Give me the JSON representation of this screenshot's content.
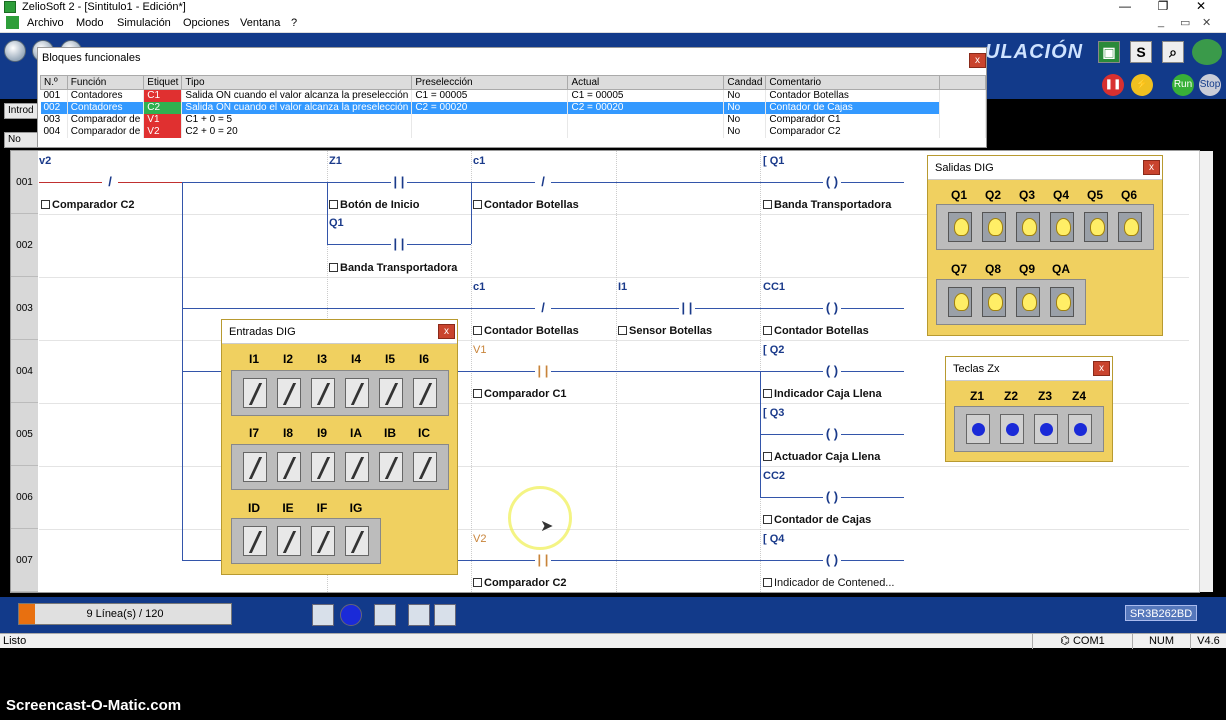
{
  "window": {
    "title": "ZelioSoft 2 - [Sintitulo1 - Edición*]",
    "min": "—",
    "max": "❐",
    "close": "✕",
    "mdi_min": "_",
    "mdi_restore": "▭",
    "mdi_close": "✕"
  },
  "menu": [
    "Archivo",
    "Modo",
    "Simulación",
    "Opciones",
    "Ventana",
    "?"
  ],
  "toolbar": {
    "mode_label": "ULACIÓN",
    "s_label": "S",
    "run_label": "Run",
    "stop_label": "Stop"
  },
  "left_tabs": [
    "Introd",
    "No"
  ],
  "function_blocks": {
    "title": "Bloques funcionales",
    "close": "x",
    "headers": [
      "N.º",
      "Función",
      "Etiquet",
      "Tipo",
      "Preselección",
      "Actual",
      "Candad",
      "Comentario"
    ],
    "rows": [
      [
        "001",
        "Contadores",
        "C1",
        "Salida ON cuando el valor alcanza la preselección",
        "C1 = 00005",
        "C1 = 00005",
        "No",
        "Contador Botellas"
      ],
      [
        "002",
        "Contadores",
        "C2",
        "Salida ON cuando el valor alcanza la preselección",
        "C2 = 00020",
        "C2 = 00020",
        "No",
        "Contador de Cajas"
      ],
      [
        "003",
        "Comparador de",
        "V1",
        "C1 + 0 = 5",
        "",
        "",
        "No",
        "Comparador C1"
      ],
      [
        "004",
        "Comparador de",
        "V2",
        "C2 + 0 = 20",
        "",
        "",
        "No",
        "Comparador C2"
      ]
    ]
  },
  "ladder": {
    "rows": [
      "001",
      "002",
      "003",
      "004",
      "005",
      "006",
      "007"
    ],
    "labels": {
      "r1_v2": "v2",
      "r1_z1": "Z1",
      "r1_c1": "c1",
      "r1_q1": "[ Q1",
      "r1_cm_v2": "Comparador C2",
      "r1_cm_z1": "Botón de Inicio",
      "r1_cm_c1": "Contador Botellas",
      "r1_cm_q1": "Banda Transportadora",
      "r2_q1": "Q1",
      "r2_cm_q1": "Banda Transportadora",
      "r3_c1": "c1",
      "r3_i1": "I1",
      "r3_cc1": "CC1",
      "r3_cm_c1": "Contador Botellas",
      "r3_cm_i1": "Sensor Botellas",
      "r3_cm_cc1": "Contador Botellas",
      "r4_v1": "V1",
      "r4_q2": "[ Q2",
      "r4_cm_v1": "Comparador C1",
      "r4_cm_q2": "Indicador Caja Llena",
      "r5_q3": "[ Q3",
      "r5_cm_q3": "Actuador Caja Llena",
      "r6_cc2": "CC2",
      "r6_cm_cc2": "Contador de Cajas",
      "r7_v2": "V2",
      "r7_q4": "[ Q4",
      "r7_cm_v2": "Comparador C2",
      "r7_cm_q4": "Indicador de Contened..."
    }
  },
  "entradas": {
    "title": "Entradas DIG",
    "close": "x",
    "row1": [
      "I1",
      "I2",
      "I3",
      "I4",
      "I5",
      "I6"
    ],
    "row2": [
      "I7",
      "I8",
      "I9",
      "IA",
      "IB",
      "IC"
    ],
    "row3": [
      "ID",
      "IE",
      "IF",
      "IG"
    ]
  },
  "salidas": {
    "title": "Salidas DIG",
    "close": "x",
    "row1": [
      "Q1",
      "Q2",
      "Q3",
      "Q4",
      "Q5",
      "Q6"
    ],
    "row2": [
      "Q7",
      "Q8",
      "Q9",
      "QA"
    ]
  },
  "teclas": {
    "title": "Teclas Zx",
    "close": "x",
    "keys": [
      "Z1",
      "Z2",
      "Z3",
      "Z4"
    ]
  },
  "bottom": {
    "lines": "9 Línea(s) / 120",
    "model": "SR3B262BD"
  },
  "status": {
    "left": "Listo",
    "com": "COM1",
    "num": "NUM",
    "version": "V4.6"
  },
  "watermark": "Screencast-O-Matic.com"
}
